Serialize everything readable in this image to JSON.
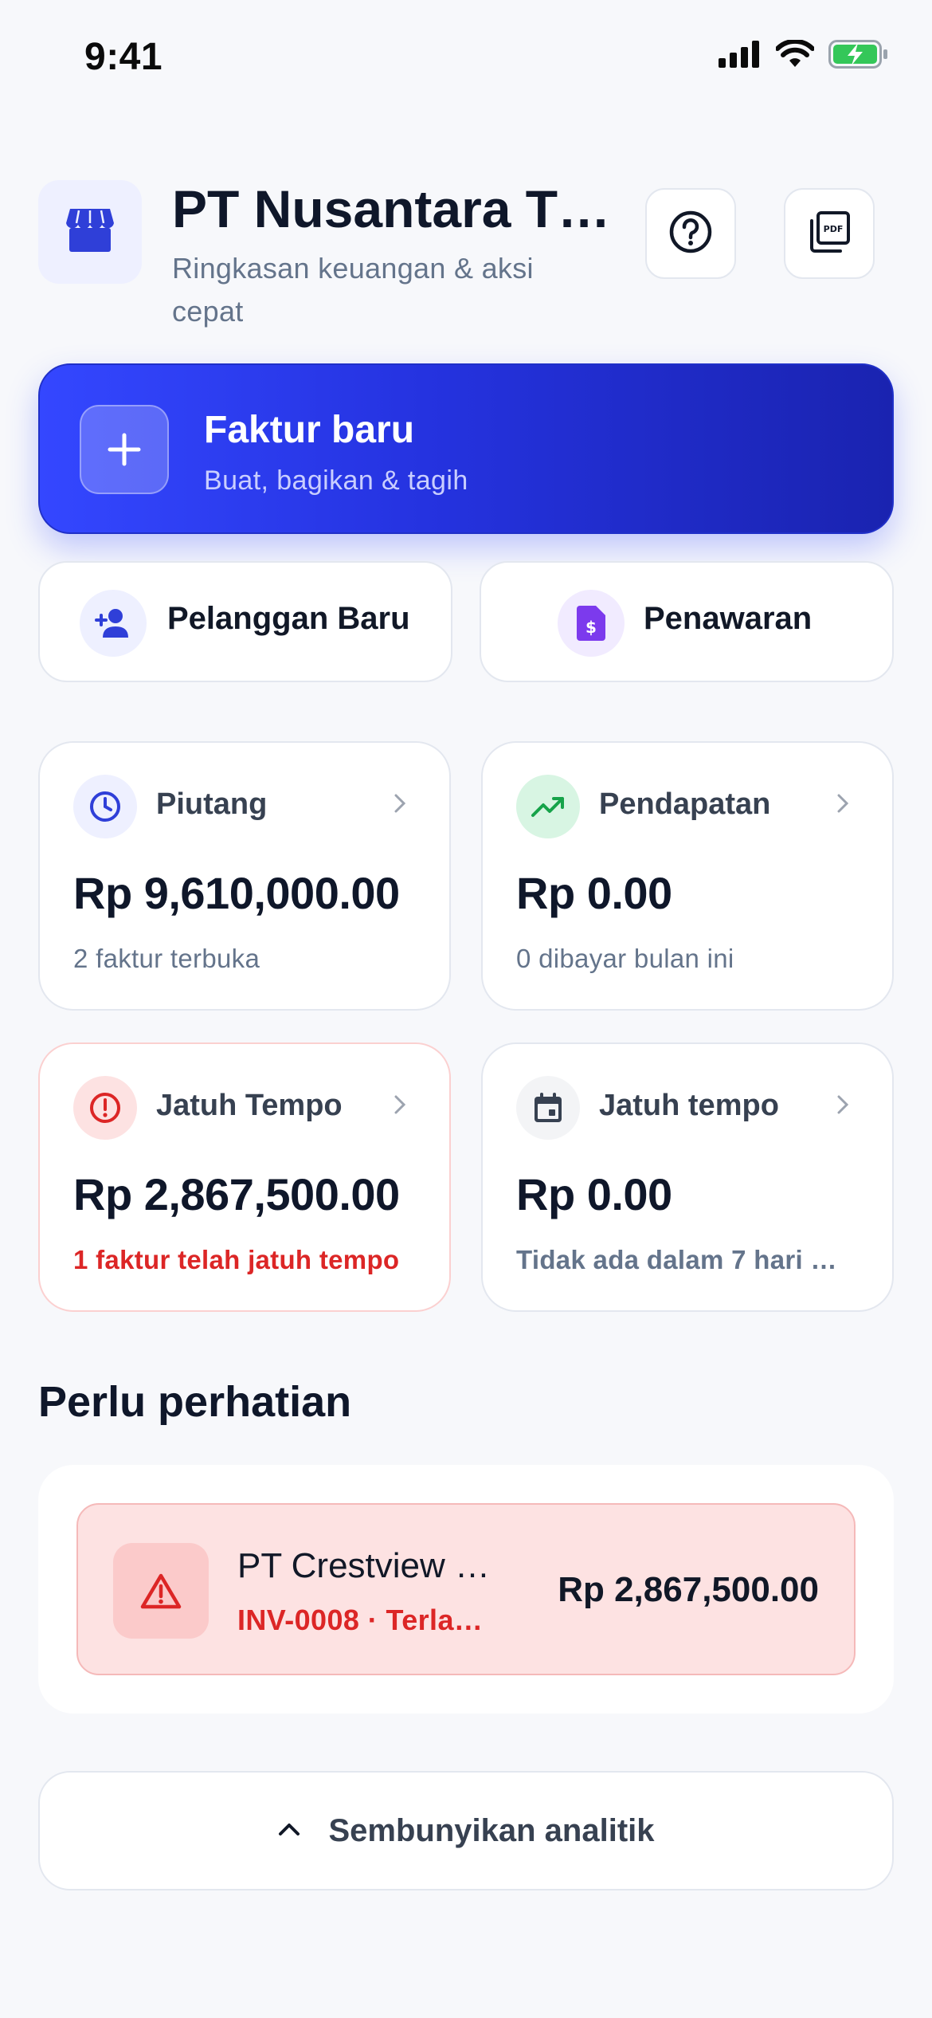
{
  "status_bar": {
    "time": "9:41"
  },
  "header": {
    "title": "PT Nusantara T…",
    "subtitle": "Ringkasan keuangan & aksi cepat"
  },
  "hero": {
    "title": "Faktur baru",
    "subtitle": "Buat, bagikan & tagih"
  },
  "quick_actions": [
    {
      "label": "Pelanggan Baru",
      "icon": "add-person-icon"
    },
    {
      "label": "Penawaran",
      "icon": "quote-document-icon"
    }
  ],
  "stats": [
    {
      "label": "Piutang",
      "value": "Rp 9,610,000.00",
      "note": "2 faktur terbuka",
      "icon": "clock-icon",
      "accent": "#2f3fd8"
    },
    {
      "label": "Pendapatan",
      "value": "Rp 0.00",
      "note": "0 dibayar bulan ini",
      "icon": "trending-up-icon",
      "accent": "#16a34a"
    },
    {
      "label": "Jatuh Tempo",
      "value": "Rp 2,867,500.00",
      "note": "1 faktur telah jatuh tempo",
      "icon": "alert-circle-icon",
      "accent": "#dc2626"
    },
    {
      "label": "Jatuh tempo",
      "value": "Rp 0.00",
      "note": "Tidak ada dalam 7 hari …",
      "icon": "calendar-icon",
      "accent": "#374151"
    }
  ],
  "attention": {
    "title": "Perlu perhatian",
    "items": [
      {
        "name": "PT Crestview …",
        "sub": "INV-0008 · Terla…",
        "amount": "Rp 2,867,500.00",
        "icon": "warning-triangle-icon"
      }
    ]
  },
  "analytics_toggle": {
    "label": "Sembunyikan analitik"
  },
  "colors": {
    "brand": "#3447ff",
    "danger": "#dc2626",
    "success": "#16a34a",
    "background": "#f7f8fb"
  }
}
